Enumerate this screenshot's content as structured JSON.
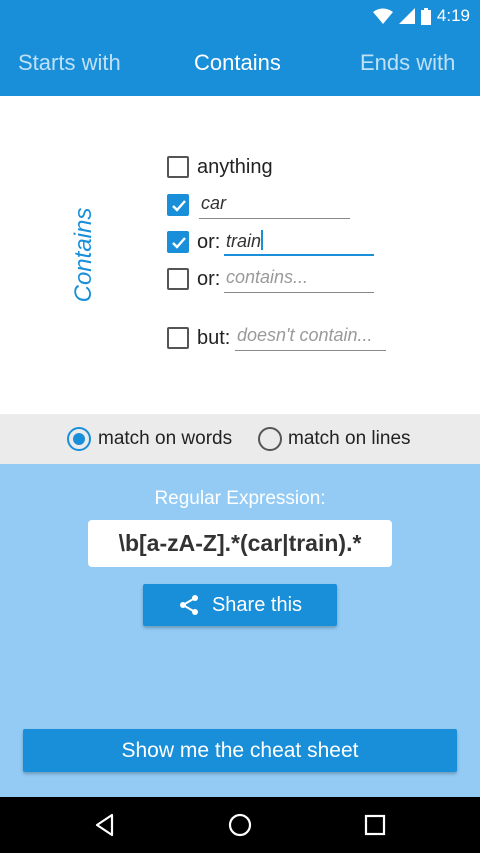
{
  "status_bar": {
    "time": "4:19",
    "icons": [
      "wifi-icon",
      "signal-icon",
      "battery-icon"
    ]
  },
  "tabs": [
    {
      "label": "Starts with",
      "active": false
    },
    {
      "label": "Contains",
      "active": true
    },
    {
      "label": "Ends with",
      "active": false
    }
  ],
  "form": {
    "side_label": "Contains",
    "anything": {
      "label": "anything",
      "checked": false
    },
    "term1": {
      "checked": true,
      "value": "car"
    },
    "term2": {
      "checked": true,
      "prefix": "or:",
      "value": "train"
    },
    "term3": {
      "checked": false,
      "prefix": "or:",
      "placeholder": "contains..."
    },
    "exclude": {
      "checked": false,
      "prefix": "but:",
      "placeholder": "doesn't contain..."
    }
  },
  "match_mode": {
    "words_label": "match on words",
    "lines_label": "match on lines",
    "selected": "words"
  },
  "result": {
    "label": "Regular Expression:",
    "regex": "\\b[a-zA-Z].*(car|train).*",
    "share_label": "Share this",
    "cheat_sheet_label": "Show me the cheat sheet"
  },
  "colors": {
    "accent": "#1a8fd9",
    "result_bg": "#93cbf5",
    "match_bar_bg": "#ebebeb"
  }
}
